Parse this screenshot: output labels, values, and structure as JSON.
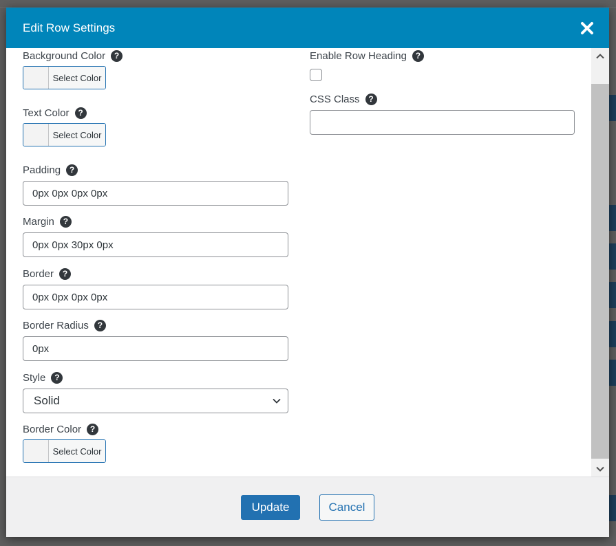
{
  "modal": {
    "title": "Edit Row Settings"
  },
  "fields": {
    "background_color": {
      "label": "Background Color",
      "button": "Select Color"
    },
    "text_color": {
      "label": "Text Color",
      "button": "Select Color"
    },
    "padding": {
      "label": "Padding",
      "value": "0px 0px 0px 0px"
    },
    "margin": {
      "label": "Margin",
      "value": "0px 0px 30px 0px"
    },
    "border": {
      "label": "Border",
      "value": "0px 0px 0px 0px"
    },
    "border_radius": {
      "label": "Border Radius",
      "value": "0px"
    },
    "style": {
      "label": "Style",
      "value": "Solid"
    },
    "border_color": {
      "label": "Border Color",
      "button": "Select Color"
    },
    "enable_row_heading": {
      "label": "Enable Row Heading",
      "checked": false
    },
    "css_class": {
      "label": "CSS Class",
      "value": ""
    }
  },
  "help_glyph": "?",
  "footer": {
    "update": "Update",
    "cancel": "Cancel"
  },
  "colors": {
    "header": "#0085ba",
    "primary": "#2271b1",
    "footer_bg": "#f0f0f1"
  },
  "icons": {
    "close": "close-icon",
    "help": "help-icon",
    "chevron": "chevron-down-icon"
  }
}
